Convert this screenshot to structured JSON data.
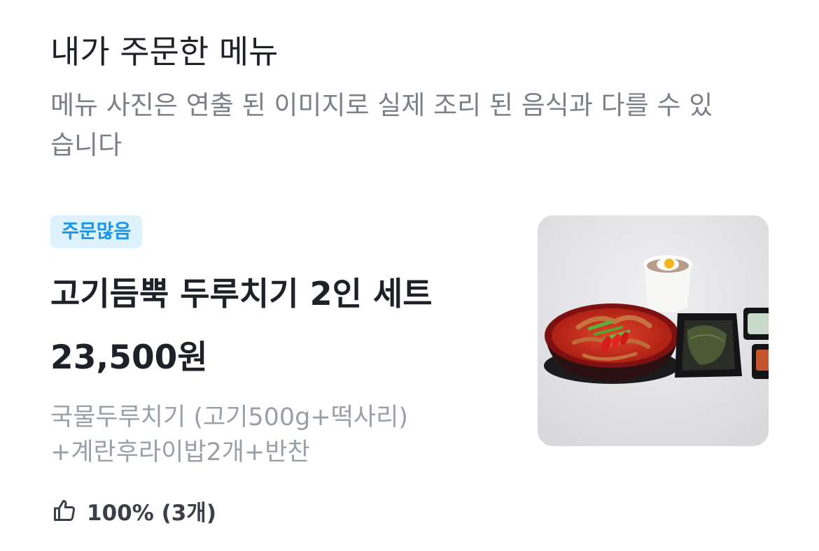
{
  "section": {
    "title": "내가 주문한 메뉴",
    "notice": "메뉴 사진은 연출 된 이미지로 실제 조리 된 음식과 다를 수 있습니다"
  },
  "menu_item": {
    "badge": "주문많음",
    "name": "고기듬뿍 두루치기 2인 세트",
    "price": "23,500원",
    "description_line1": "국물두루치기 (고기500g+떡사리)",
    "description_line2": "+계란후라이밥2개+반찬",
    "rating_icon": "thumbs-up-icon",
    "rating": "100% (3개)",
    "photo_subject": "food-photo"
  },
  "colors": {
    "badge_bg": "#def2fd",
    "badge_text": "#1a95ee",
    "title_text": "#1e2228",
    "muted_text": "#7b8088"
  }
}
